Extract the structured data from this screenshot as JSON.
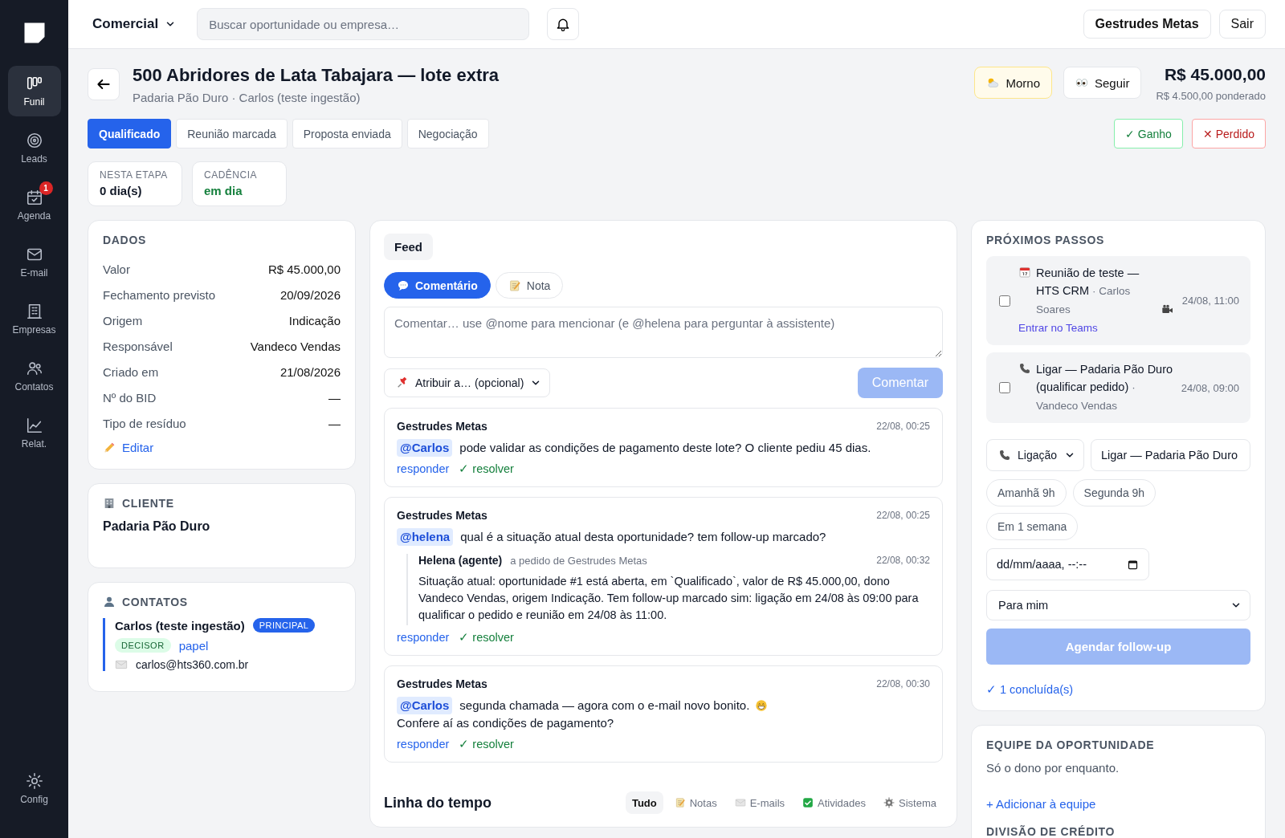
{
  "sidebar": {
    "items": [
      {
        "label": "Funil",
        "selected": true,
        "kind": "funnel"
      },
      {
        "label": "Leads",
        "selected": false,
        "kind": "target"
      },
      {
        "label": "Agenda",
        "selected": false,
        "kind": "calendar",
        "badge": "1"
      },
      {
        "label": "E-mail",
        "selected": false,
        "kind": "mail"
      },
      {
        "label": "Empresas",
        "selected": false,
        "kind": "building"
      },
      {
        "label": "Contatos",
        "selected": false,
        "kind": "people"
      },
      {
        "label": "Relat.",
        "selected": false,
        "kind": "chart"
      }
    ],
    "footer": {
      "label": "Config",
      "kind": "settings"
    }
  },
  "topbar": {
    "workspace": "Comercial",
    "search": {
      "placeholder": "Buscar oportunidade ou empresa…"
    },
    "user": "Gestrudes Metas",
    "logout": "Sair"
  },
  "deal": {
    "title": "500 Abridores de Lata Tabajara — lote extra",
    "subtitle": "Padaria Pão Duro · Carlos (teste ingestão)",
    "temperature": "Morno",
    "follow": "Seguir",
    "value": "R$ 45.000,00",
    "weighted": "R$ 4.500,00 ponderado",
    "stages": [
      {
        "label": "Qualificado",
        "selected": true
      },
      {
        "label": "Reunião marcada",
        "selected": false
      },
      {
        "label": "Proposta enviada",
        "selected": false
      },
      {
        "label": "Negociação",
        "selected": false
      }
    ],
    "won": "✓ Ganho",
    "lost": "✕ Perdido",
    "stats": [
      {
        "label": "NESTA ETAPA",
        "value": "0 dia(s)",
        "kind": "plain"
      },
      {
        "label": "CADÊNCIA",
        "value": "em dia",
        "kind": "good"
      }
    ]
  },
  "data": {
    "title": "DADOS",
    "rows": [
      {
        "label": "Valor",
        "value": "R$ 45.000,00"
      },
      {
        "label": "Fechamento previsto",
        "value": "20/09/2026"
      },
      {
        "label": "Origem",
        "value": "Indicação"
      },
      {
        "label": "Responsável",
        "value": "Vandeco Vendas"
      },
      {
        "label": "Criado em",
        "value": "21/08/2026"
      },
      {
        "label": "Nº do BID",
        "value": "—"
      },
      {
        "label": "Tipo de resíduo",
        "value": "—"
      }
    ],
    "edit": "Editar"
  },
  "client": {
    "title": "CLIENTE",
    "name": "Padaria Pão Duro"
  },
  "contacts": {
    "title": "CONTATOS",
    "items": [
      {
        "name": "Carlos (teste ingestão)",
        "badge": "PRINCIPAL",
        "role": "DECISOR",
        "role_link": "papel",
        "email": "carlos@hts360.com.br"
      }
    ]
  },
  "feed": {
    "tab": "Feed",
    "modes": [
      {
        "label": "Comentário",
        "selected": true,
        "kind": "comment"
      },
      {
        "label": "Nota",
        "selected": false,
        "kind": "note"
      }
    ],
    "comment_box": {
      "placeholder": "Comentar… use @nome para mencionar (e @helena para perguntar à assistente)"
    },
    "assign": "Atribuir a… (opcional)",
    "submit": {
      "label": "Comentar",
      "disabled": true
    },
    "comments": [
      {
        "author": "Gestrudes Metas",
        "time": "22/08, 00:25",
        "body": [
          {
            "kind": "mention",
            "text": "@Carlos"
          },
          {
            "kind": "text",
            "text": "pode validar as condições de pagamento deste lote? O cliente pediu 45 dias."
          }
        ],
        "reply": "responder",
        "resolve": "✓ resolver"
      },
      {
        "author": "Gestrudes Metas",
        "time": "22/08, 00:25",
        "body": [
          {
            "kind": "mention",
            "text": "@helena"
          },
          {
            "kind": "text",
            "text": "qual é a situação atual desta oportunidade? tem follow-up marcado?"
          }
        ],
        "answer": {
          "author": "Helena (agente)",
          "context": "a pedido de Gestrudes Metas",
          "time": "22/08, 00:32",
          "text": "Situação atual: oportunidade #1 está aberta, em `Qualificado`, valor de R$ 45.000,00, dono Vandeco Vendas, origem Indicação. Tem follow-up marcado sim: ligação em 24/08 às 09:00 para qualificar o pedido e reunião em 24/08 às 11:00."
        },
        "reply": "responder",
        "resolve": "✓ resolver"
      },
      {
        "author": "Gestrudes Metas",
        "time": "22/08, 00:30",
        "body": [
          {
            "kind": "mention",
            "text": "@Carlos"
          },
          {
            "kind": "text",
            "text": "segunda chamada — agora com o e-mail novo bonito."
          },
          {
            "kind": "smiley"
          },
          {
            "kind": "text",
            "text": "Confere aí as condições de pagamento?"
          }
        ],
        "reply": "responder",
        "resolve": "✓ resolver"
      }
    ]
  },
  "timeline": {
    "title": "Linha do tempo",
    "filters": [
      {
        "label": "Tudo",
        "selected": true,
        "kind": "all"
      },
      {
        "label": "Notas",
        "selected": false,
        "kind": "note"
      },
      {
        "label": "E-mails",
        "selected": false,
        "kind": "mail"
      },
      {
        "label": "Atividades",
        "selected": false,
        "kind": "check"
      },
      {
        "label": "Sistema",
        "selected": false,
        "kind": "gear"
      }
    ]
  },
  "next_steps": {
    "title": "PRÓXIMOS PASSOS",
    "tasks": [
      {
        "kind": "meeting",
        "title": "Reunião de teste — HTS CRM",
        "person": "· Carlos Soares",
        "video_call": true,
        "time": "24/08, 11:00",
        "link": "Entrar no Teams",
        "checked": false
      },
      {
        "kind": "call",
        "title": "Ligar — Padaria Pão Duro (qualificar pedido)",
        "person": "· Vandeco Vendas",
        "video_call": false,
        "time": "24/08, 09:00",
        "checked": false
      }
    ],
    "form": {
      "type": "Ligação",
      "title_value": "Ligar — Padaria Pão Duro",
      "quick": [
        "Amanhã 9h",
        "Segunda 9h",
        "Em 1 semana"
      ],
      "datetime": "dd/mm/aaaa, --:--",
      "assignee": "Para mim",
      "submit": {
        "label": "Agendar follow-up",
        "disabled": true
      }
    },
    "done": "✓ 1 concluída(s)"
  },
  "team": {
    "title": "EQUIPE DA OPORTUNIDADE",
    "empty": "Só o dono por enquanto.",
    "add": "+ Adicionar à equipe",
    "credit_title": "DIVISÃO DE CRÉDITO"
  }
}
